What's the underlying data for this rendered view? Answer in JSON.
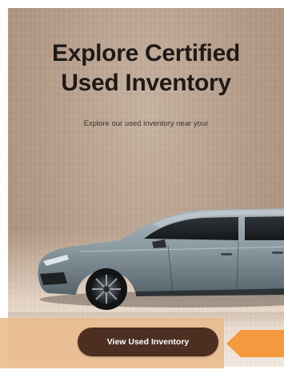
{
  "hero": {
    "headline_line1": "Explore Certified",
    "headline_line2": "Used Inventory",
    "subtext": "Explore our used inventory near your"
  },
  "cta": {
    "label": "View Used Inventory"
  },
  "colors": {
    "button_bg": "#4d2f22",
    "highlight": "#e9b98c",
    "arrow": "#f39a3e",
    "headline_text": "#1f1a17"
  },
  "icons": {
    "car": "car-image",
    "arrow": "arrow-left-indicator-icon"
  }
}
